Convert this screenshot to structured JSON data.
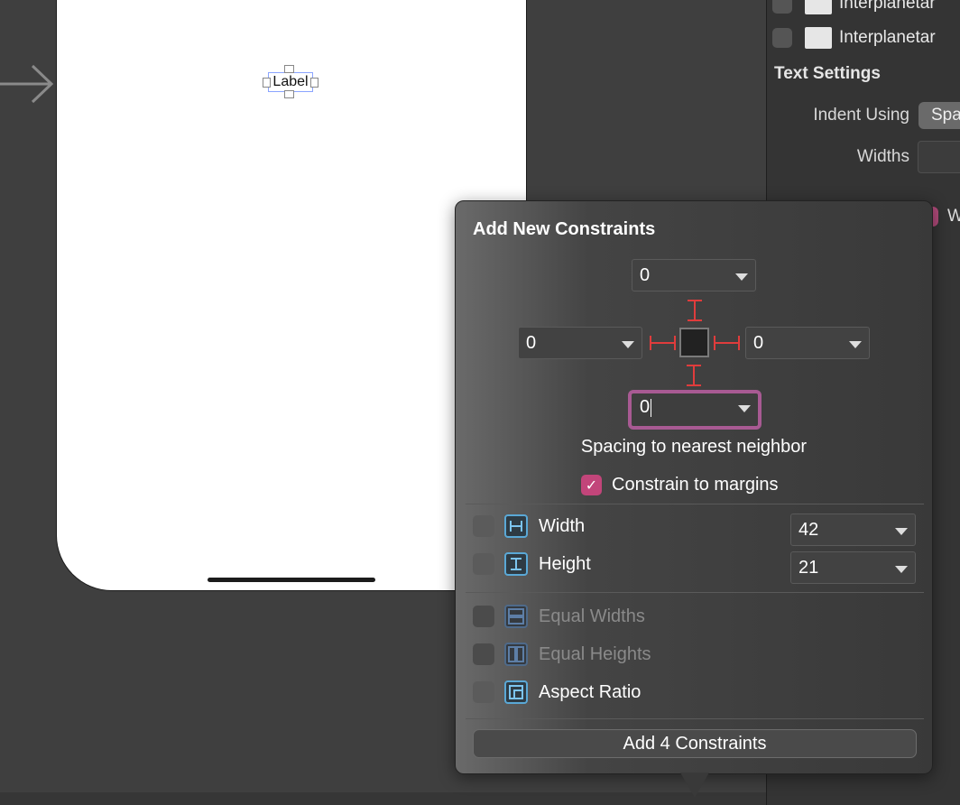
{
  "canvas": {
    "label_text": "Label"
  },
  "inspector": {
    "files": [
      {
        "name": "Interplanetar"
      },
      {
        "name": "Interplanetar"
      }
    ],
    "text_settings_title": "Text Settings",
    "indent_using_label": "Indent Using",
    "indent_using_value": "Spa",
    "widths_label": "Widths",
    "wrap_label_partial": "W"
  },
  "popover": {
    "title": "Add New Constraints",
    "top_value": "0",
    "left_value": "0",
    "right_value": "0",
    "bottom_value": "0",
    "spacing_caption": "Spacing to nearest neighbor",
    "constrain_margins_label": "Constrain to margins",
    "constrain_margins_checked": true,
    "width_label": "Width",
    "width_value": "42",
    "height_label": "Height",
    "height_value": "21",
    "equal_widths_label": "Equal Widths",
    "equal_heights_label": "Equal Heights",
    "aspect_ratio_label": "Aspect Ratio",
    "add_button_label": "Add 4 Constraints"
  },
  "colors": {
    "accent_pink": "#c2457a",
    "strut_red": "#e03c3c",
    "icon_blue": "#5aa8d6"
  }
}
